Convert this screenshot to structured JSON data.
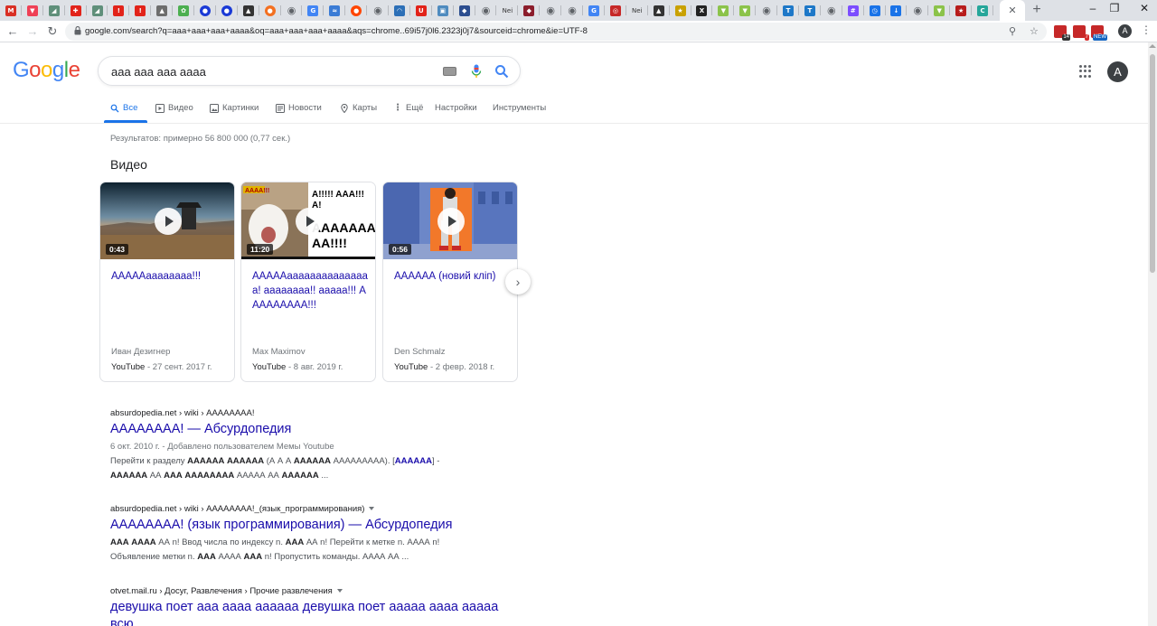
{
  "browser": {
    "tabs": [
      {
        "icon": "gmail-icon",
        "color": "#d93025",
        "glyph": "M"
      },
      {
        "icon": "pocket-icon",
        "color": "#ef4056",
        "glyph": "▼"
      },
      {
        "icon": "sheet-icon",
        "color": "#5f8f7a",
        "glyph": "◢"
      },
      {
        "icon": "shield-icon",
        "color": "#e2231a",
        "glyph": "✚"
      },
      {
        "icon": "sheet-icon",
        "color": "#5f8f7a",
        "glyph": "◢"
      },
      {
        "icon": "red-square-icon",
        "color": "#e2231a",
        "glyph": "!"
      },
      {
        "icon": "red-square-icon",
        "color": "#e2231a",
        "glyph": "!"
      },
      {
        "icon": "cap-icon",
        "color": "#6d6d6d",
        "glyph": "▲"
      },
      {
        "icon": "leaf-icon",
        "color": "#4caf50",
        "glyph": "✿"
      },
      {
        "icon": "blue-dot-icon",
        "color": "#1a3ad6",
        "glyph": "●"
      },
      {
        "icon": "blue-dot-icon",
        "color": "#1a3ad6",
        "glyph": "●"
      },
      {
        "icon": "penguin-icon",
        "color": "#333333",
        "glyph": "▲"
      },
      {
        "icon": "orange-round-icon",
        "color": "#f37021",
        "glyph": "●"
      },
      {
        "icon": "globe-icon",
        "color": "#5f6368",
        "glyph": "◉"
      },
      {
        "icon": "google-icon",
        "color": "#4285f4",
        "glyph": "G"
      },
      {
        "icon": "swirl-icon",
        "color": "#3a7bd5",
        "glyph": "≈"
      },
      {
        "icon": "reddit-icon",
        "color": "#ff4500",
        "glyph": "●"
      },
      {
        "icon": "globe-icon",
        "color": "#5f6368",
        "glyph": "◉"
      },
      {
        "icon": "wifi-icon",
        "color": "#2c6fb7",
        "glyph": "◠"
      },
      {
        "icon": "magnet-icon",
        "color": "#e2231a",
        "glyph": "U"
      },
      {
        "icon": "box-icon",
        "color": "#4f8bbf",
        "glyph": "▣"
      },
      {
        "icon": "diamond-icon",
        "color": "#2b4d8f",
        "glyph": "◆"
      },
      {
        "icon": "globe-icon",
        "color": "#5f6368",
        "glyph": "◉"
      },
      {
        "icon": "text-icon",
        "color": "#333333",
        "glyph": "Nei"
      },
      {
        "icon": "shield-icon",
        "color": "#8b1d2c",
        "glyph": "◆"
      },
      {
        "icon": "globe-icon",
        "color": "#5f6368",
        "glyph": "◉"
      },
      {
        "icon": "globe-icon",
        "color": "#5f6368",
        "glyph": "◉"
      },
      {
        "icon": "google-icon",
        "color": "#4285f4",
        "glyph": "G"
      },
      {
        "icon": "lock-red-icon",
        "color": "#c62828",
        "glyph": "◎"
      },
      {
        "icon": "text-icon",
        "color": "#333333",
        "glyph": "Nei"
      },
      {
        "icon": "penguin-icon",
        "color": "#333333",
        "glyph": "▲"
      },
      {
        "icon": "star-icon",
        "color": "#c9a100",
        "glyph": "★"
      },
      {
        "icon": "x-icon",
        "color": "#222222",
        "glyph": "X"
      },
      {
        "icon": "cup-icon",
        "color": "#8bc34a",
        "glyph": "▼"
      },
      {
        "icon": "cup-icon",
        "color": "#8bc34a",
        "glyph": "▼"
      },
      {
        "icon": "globe-icon",
        "color": "#5f6368",
        "glyph": "◉"
      },
      {
        "icon": "t-icon",
        "color": "#1e78c8",
        "glyph": "T"
      },
      {
        "icon": "t-icon",
        "color": "#1e78c8",
        "glyph": "T"
      },
      {
        "icon": "globe-icon",
        "color": "#5f6368",
        "glyph": "◉"
      },
      {
        "icon": "hash-icon",
        "color": "#7c4dff",
        "glyph": "#"
      },
      {
        "icon": "clock-icon",
        "color": "#1a73e8",
        "glyph": "◷"
      },
      {
        "icon": "download-icon",
        "color": "#1a73e8",
        "glyph": "↓"
      },
      {
        "icon": "globe-icon",
        "color": "#5f6368",
        "glyph": "◉"
      },
      {
        "icon": "cup-icon",
        "color": "#8bc34a",
        "glyph": "▼"
      },
      {
        "icon": "star-red-icon",
        "color": "#b71c1c",
        "glyph": "★"
      },
      {
        "icon": "c-icon",
        "color": "#26a69a",
        "glyph": "C"
      }
    ],
    "url": "google.com/search?q=aaa+aaa+aaa+aaaa&oq=aaa+aaa+aaa+aaaa&aqs=chrome..69i57j0l6.2323j0j7&sourceid=chrome&ie=UTF-8",
    "extension_badges": [
      "14",
      "7",
      "NEW"
    ],
    "profile_initial": "A"
  },
  "google": {
    "query": "aaa aaa aaa aaaa",
    "avatar_initial": "A",
    "tabs": [
      "Все",
      "Видео",
      "Картинки",
      "Новости",
      "Карты",
      "Ещё",
      "Настройки",
      "Инструменты"
    ],
    "stats": "Результатов: примерно 56 800 000 (0,77 сек.)"
  },
  "videos": {
    "heading": "Видео",
    "items": [
      {
        "title": "ААААAaaaaaaaa!!!",
        "duration": "0:43",
        "author": "Иван Дезигнер",
        "source": "YouTube",
        "date": "- 27 сент. 2017 г."
      },
      {
        "title": "ААААAaaaaaaaaaaaaaaa! aaaaaaaa!! aaaaa!!! ААААААААA!!!",
        "duration": "11:20",
        "author": "Max Maximov",
        "source": "YouTube",
        "date": "- 8 авг. 2019 г."
      },
      {
        "title": "АААААА (новий кліп)",
        "duration": "0:56",
        "author": "Den Schmalz",
        "source": "YouTube",
        "date": "- 2 февр. 2018 г."
      }
    ],
    "thumb2_text": "A!!!!!  AAA!!!\nA!\nAAAAAAA\nAA!!!!"
  },
  "results": [
    {
      "cite": "absurdopedia.net › wiki › АААААААА!",
      "title": "АААААААА! — Абсурдопедия",
      "date": "6 окт. 2010 г. - Добавлено пользователем Мемы Youtube",
      "line1_prefix": "Перейти к разделу ",
      "line1_bold": "АААААА АААААА",
      "line1_mid": " (А А А ",
      "line1_bold2": "АААААА",
      "line1_rest": " ААААААААА). [",
      "line1_link": "АААААА",
      "line1_end": "] -",
      "line2_bold": "АААААА",
      "line2_mid": " АА ",
      "line2_bold2": "ААА АААААААА",
      "line2_mid2": " ААААА АА ",
      "line2_bold3": "АААААА",
      "line2_end": " ..."
    },
    {
      "cite": "absurdopedia.net › wiki › АААААААА!_(язык_программирования)",
      "title": "АААААААА! (язык программирования) — Абсурдопедия",
      "line1_bold": "ААА АААА",
      "line1_mid": " АА n! Ввод числа по индексу n. ",
      "line1_bold2": "ААА",
      "line1_rest": " АА n! Перейти к метке n. АААА n!",
      "line2_prefix": "Объявление метки n. ",
      "line2_bold": "ААА",
      "line2_mid": " АААА ",
      "line2_bold2": "ААА",
      "line2_end": " n! Пропустить команды. АААА АА ..."
    },
    {
      "cite": "otvet.mail.ru › Досуг, Развлечения › Прочие развлечения",
      "title": "девушка поет ааа аааа аааааа девушка поет ааааа аааа ааааа всю..."
    }
  ]
}
